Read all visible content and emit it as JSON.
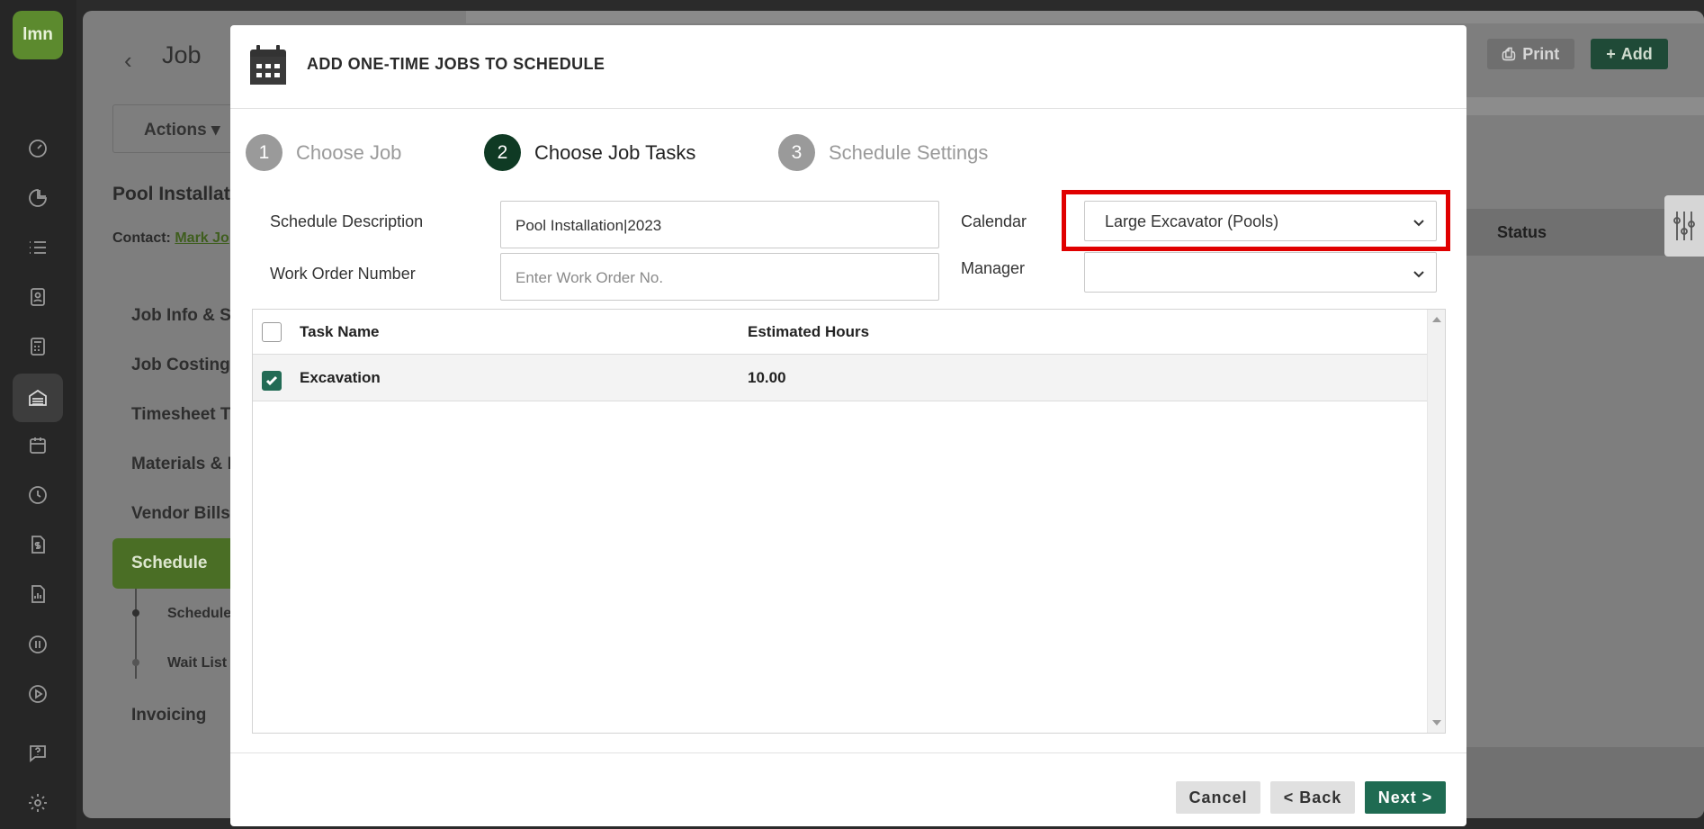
{
  "app": {
    "logo_text": "lmn",
    "rail_icons": [
      "dashboard-icon",
      "reports-pie-icon",
      "list-icon",
      "contacts-icon",
      "calculator-icon",
      "jobs-building-icon",
      "calendar-icon",
      "clock-icon",
      "invoice-dollar-icon",
      "analytics-icon",
      "quickbooks-icon",
      "play-icon",
      "help-icon",
      "settings-icon"
    ],
    "accent_color": "#5c8a2e"
  },
  "background_page": {
    "title": "Job",
    "actions_label": "Actions",
    "job_name": "Pool Installati",
    "contact_label": "Contact:",
    "contact_name": "Mark Jo",
    "menu": [
      "Job Info & Se",
      "Job Costing",
      "Timesheet Tr",
      "Materials & E",
      "Vendor Bills"
    ],
    "active_menu": "Schedule",
    "sub_menu": [
      "Schedule",
      "Wait List"
    ],
    "last_menu": "Invoicing",
    "print_label": "Print",
    "add_label": "Add",
    "status_header": "Status"
  },
  "modal": {
    "title": "ADD ONE-TIME JOBS TO SCHEDULE",
    "steps": [
      {
        "number": "1",
        "label": "Choose Job",
        "active": false
      },
      {
        "number": "2",
        "label": "Choose Job Tasks",
        "active": true
      },
      {
        "number": "3",
        "label": "Schedule Settings",
        "active": false
      }
    ],
    "form": {
      "schedule_description_label": "Schedule Description",
      "schedule_description_value": "Pool Installation|2023",
      "work_order_label": "Work Order Number",
      "work_order_placeholder": "Enter Work Order No.",
      "calendar_label": "Calendar",
      "calendar_value": "Large Excavator (Pools)",
      "manager_label": "Manager",
      "manager_value": ""
    },
    "table": {
      "headers": [
        "Task Name",
        "Estimated Hours"
      ],
      "rows": [
        {
          "task_name": "Excavation",
          "estimated_hours": "10.00",
          "checked": true
        }
      ]
    },
    "footer": {
      "cancel_label": "Cancel",
      "back_label": "< Back",
      "next_label": "Next >"
    },
    "primary_color": "#1f6b52",
    "highlight_color": "#e00000"
  }
}
